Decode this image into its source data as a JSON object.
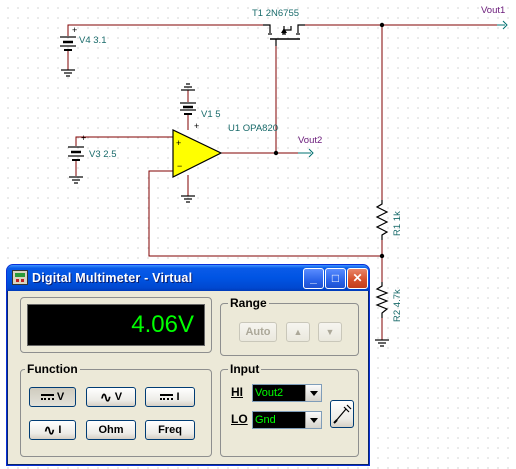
{
  "schematic": {
    "v4": {
      "name": "V4",
      "value": "3.1"
    },
    "t1": {
      "name": "T1",
      "value": "2N6755"
    },
    "vout1": "Vout1",
    "v1": {
      "name": "V1",
      "value": "5"
    },
    "u1": {
      "name": "U1",
      "value": "OPA820"
    },
    "vout2": "Vout2",
    "v3": {
      "name": "V3",
      "value": "2.5"
    },
    "r1": {
      "name": "R1",
      "value": "1k"
    },
    "r2": {
      "name": "R2",
      "value": "4.7k"
    }
  },
  "multimeter": {
    "title": "Digital Multimeter - Virtual",
    "reading": "4.06V",
    "function": {
      "label": "Function",
      "buttons": [
        "V",
        "V",
        "I",
        "I",
        "Ohm",
        "Freq"
      ]
    },
    "range": {
      "label": "Range",
      "auto_label": "Auto",
      "up_glyph": "▲",
      "down_glyph": "▼"
    },
    "input": {
      "label": "Input",
      "hi_label": "HI",
      "lo_label": "LO",
      "hi_value": "Vout2",
      "lo_value": "Gnd"
    },
    "window_buttons": {
      "minimize": "_",
      "maximize": "□",
      "close": "✕"
    }
  },
  "colors": {
    "wire": "#800000",
    "opamp_fill": "#ffff00",
    "label": "#1a6b6b",
    "probe_label": "#6a1a7a",
    "display_text": "#00ff00"
  },
  "icons": [
    "multimeter-app-icon",
    "minimize-icon",
    "maximize-icon",
    "close-icon",
    "probe-icon",
    "dropdown-arrow-icon"
  ]
}
